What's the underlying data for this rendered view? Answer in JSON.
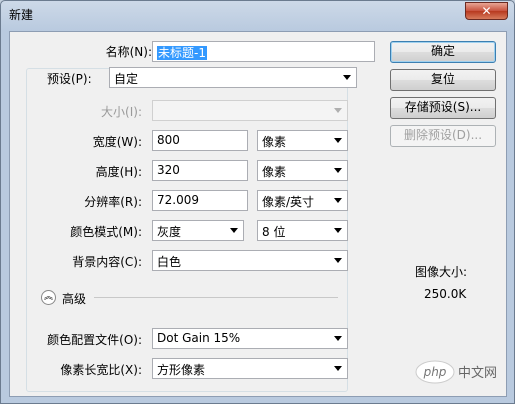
{
  "window": {
    "title": "新建",
    "close": "✕"
  },
  "form": {
    "name": {
      "label": "名称(N):",
      "value": "未标题-1"
    },
    "preset": {
      "label": "预设(P):",
      "value": "自定"
    },
    "size": {
      "label": "大小(I):",
      "value": ""
    },
    "width": {
      "label": "宽度(W):",
      "value": "800",
      "unit": "像素"
    },
    "height": {
      "label": "高度(H):",
      "value": "320",
      "unit": "像素"
    },
    "resolution": {
      "label": "分辨率(R):",
      "value": "72.009",
      "unit": "像素/英寸"
    },
    "color_mode": {
      "label": "颜色模式(M):",
      "value": "灰度",
      "depth": "8 位"
    },
    "background": {
      "label": "背景内容(C):",
      "value": "白色"
    },
    "advanced": {
      "label": "高级"
    },
    "color_profile": {
      "label": "颜色配置文件(O):",
      "value": "Dot Gain 15%"
    },
    "pixel_aspect": {
      "label": "像素长宽比(X):",
      "value": "方形像素"
    }
  },
  "buttons": {
    "ok": "确定",
    "reset": "复位",
    "save_preset": "存储预设(S)...",
    "delete_preset": "删除预设(D)..."
  },
  "image_size": {
    "label": "图像大小:",
    "value": "250.0K"
  },
  "watermark": {
    "text": "中文网",
    "logo": "php"
  },
  "colors": {
    "accent": "#3399ff",
    "title_bar": "#b9cadf",
    "close": "#c8513d"
  }
}
